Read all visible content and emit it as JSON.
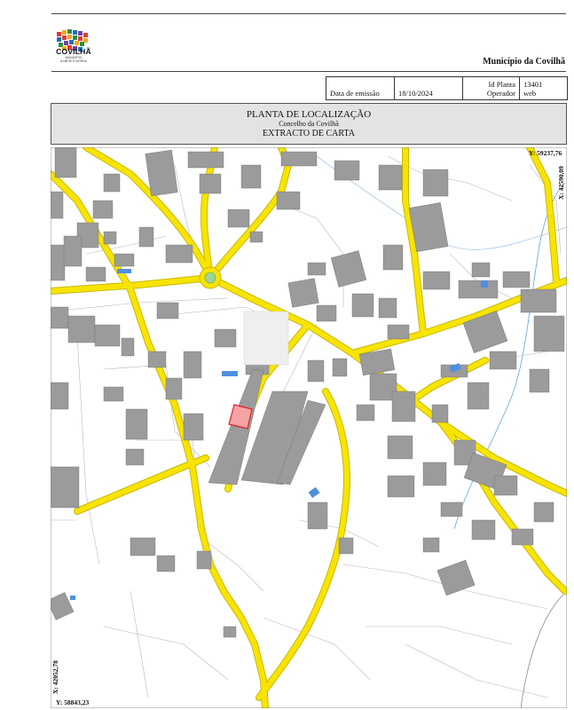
{
  "header": {
    "logo": {
      "name": "COVILHÃ",
      "tagline_1": "MUNICÍPIO",
      "tagline_2": "A NEVE E NOSSA"
    },
    "municipality": "Município da Covilhã"
  },
  "info_table": {
    "issue_date_label": "Data de emissão",
    "issue_date": "18/10/2024",
    "plan_id_label": "Id Planta",
    "plan_id": "13401",
    "operator_label": "Operador",
    "operator": "web"
  },
  "title_block": {
    "line1": "PLANTA DE LOCALIZAÇÃO",
    "line2": "Concelho da Covilhã",
    "line3": "EXTRACTO DE CARTA"
  },
  "map": {
    "coordinates": {
      "top_right_y": "Y: 59237,76",
      "top_right_x": "X: 42590,09",
      "bottom_left_x": "X: 42052,78",
      "bottom_left_y": "Y: 58843,23"
    },
    "colors": {
      "road_fill": "#f7e400",
      "road_edge": "#c8b800",
      "building": "#9b9b9b",
      "water_feature": "#4f8fe0",
      "selected_parcel": "#f5a3a3",
      "selected_parcel_border": "#e0202a",
      "roundabout_center": "#9fd39a"
    }
  }
}
